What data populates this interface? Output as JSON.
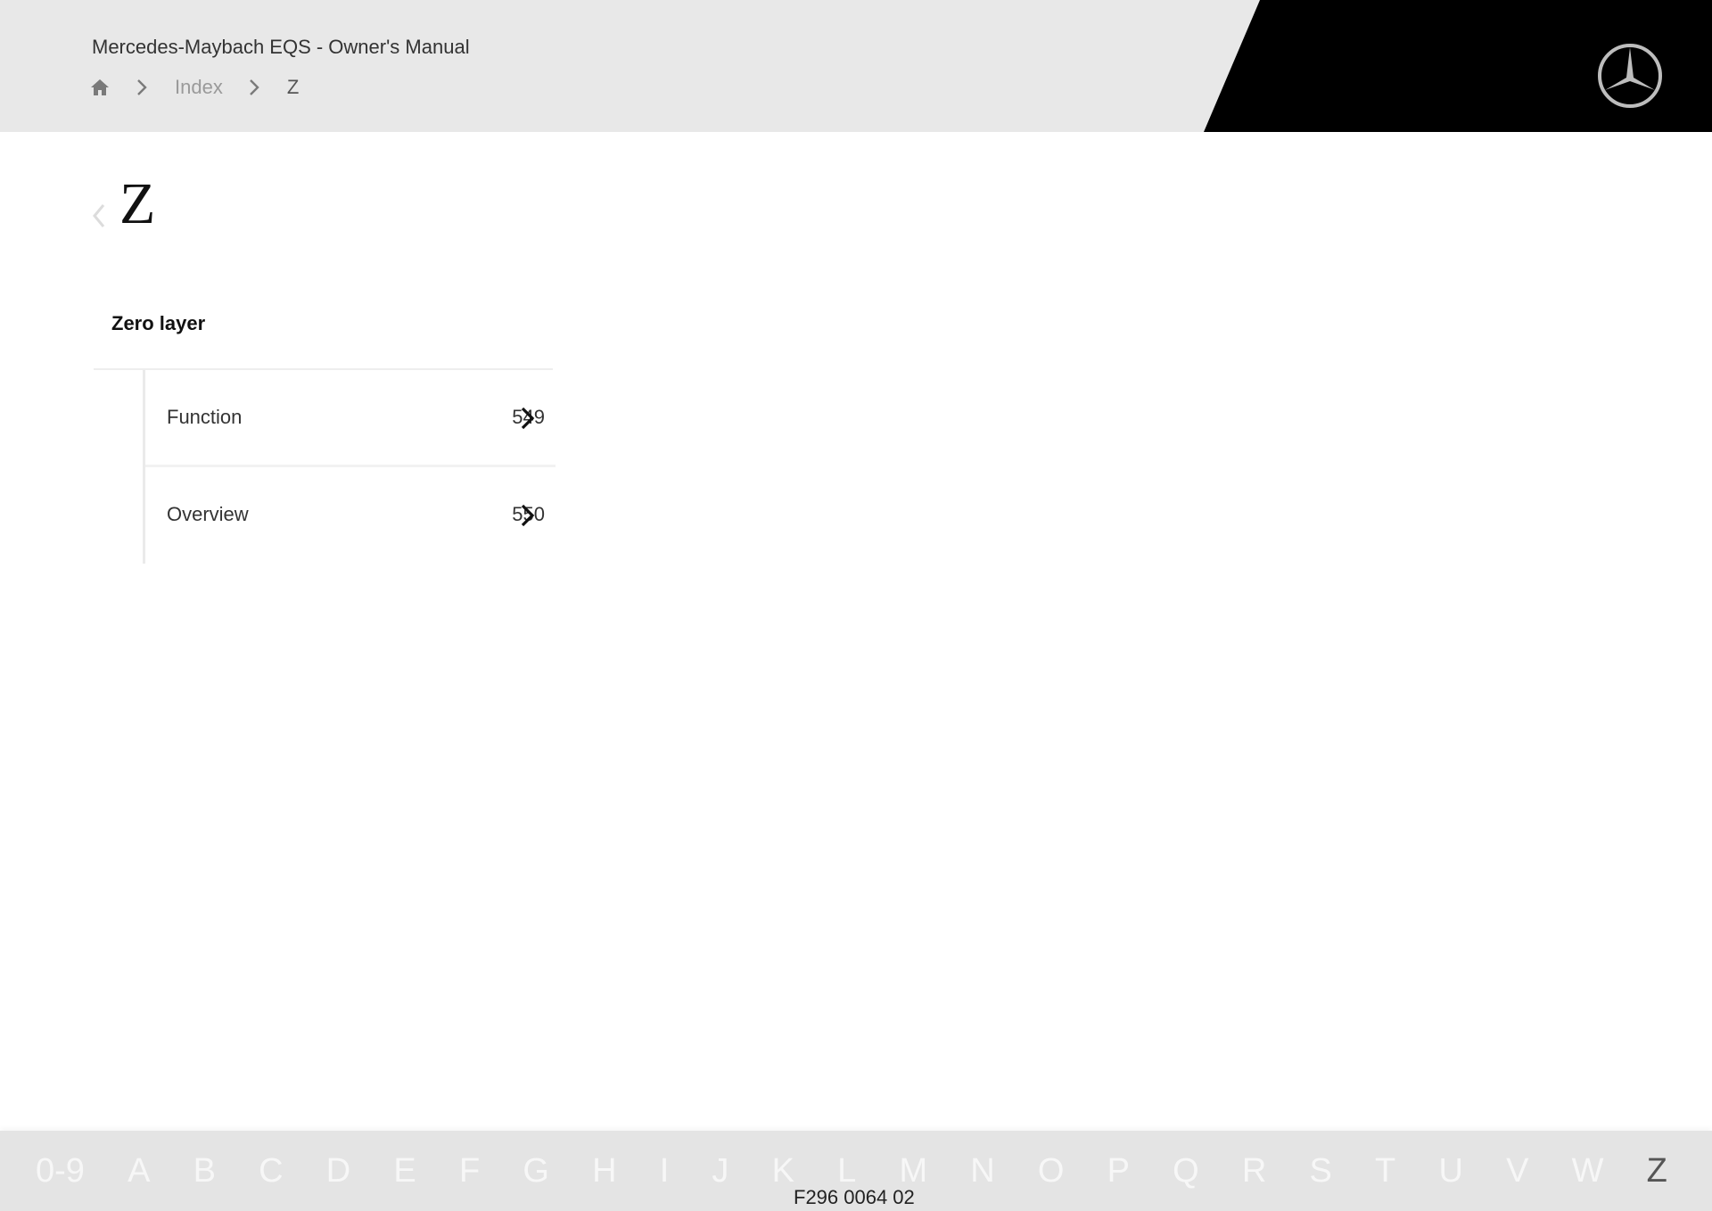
{
  "header": {
    "app_title": "Mercedes-Maybach EQS - Owner's Manual",
    "breadcrumb": {
      "home_icon": "home-icon",
      "separator_icon": "chevron-right-icon",
      "items": [
        "Index",
        "Z"
      ]
    },
    "logo": "mercedes-star-logo"
  },
  "main": {
    "back_icon": "chevron-left-icon",
    "letter": "Z",
    "groups": [
      {
        "title": "Zero layer",
        "items": [
          {
            "label": "Function",
            "page": "549"
          },
          {
            "label": "Overview",
            "page": "550"
          }
        ]
      }
    ]
  },
  "footer": {
    "alphabet": [
      "0-9",
      "A",
      "B",
      "C",
      "D",
      "E",
      "F",
      "G",
      "H",
      "I",
      "J",
      "K",
      "L",
      "M",
      "N",
      "O",
      "P",
      "Q",
      "R",
      "S",
      "T",
      "U",
      "V",
      "W",
      "Z"
    ],
    "active_letter": "Z",
    "document_code": "F296 0064 02"
  },
  "colors": {
    "header_bg": "#e8e8e8",
    "header_accent": "#000000",
    "footer_bg": "#e4e4e4",
    "active_letter": "#555555"
  }
}
